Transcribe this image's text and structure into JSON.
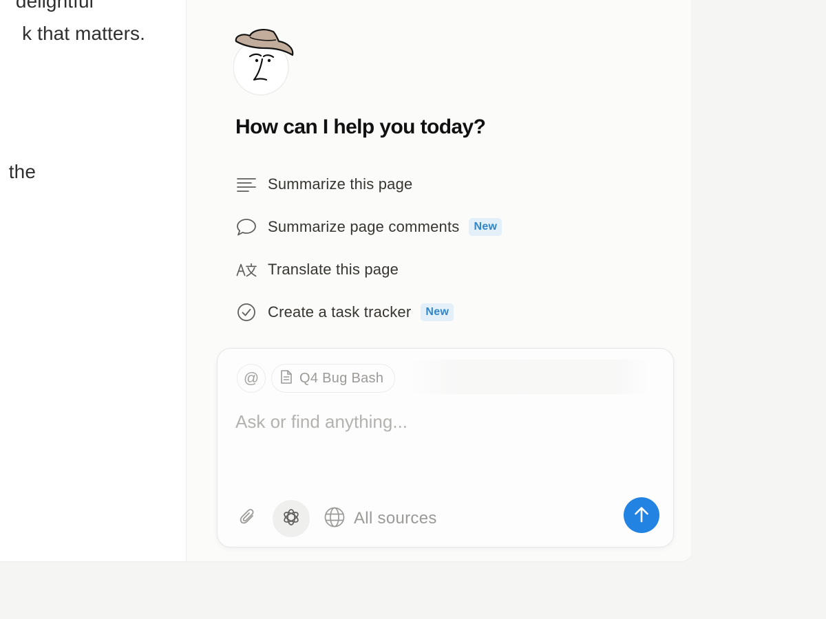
{
  "document": {
    "lines": [
      "delightful",
      "k that matters.",
      "the"
    ]
  },
  "assistant": {
    "greeting": "How can I help you today?",
    "suggestions": [
      {
        "label": "Summarize this page",
        "icon": "lines-icon",
        "badge": ""
      },
      {
        "label": "Summarize page comments",
        "icon": "speech-bubble-icon",
        "badge": "New"
      },
      {
        "label": "Translate this page",
        "icon": "translate-icon",
        "badge": ""
      },
      {
        "label": "Create a task tracker",
        "icon": "check-circle-icon",
        "badge": "New"
      }
    ]
  },
  "composer": {
    "mention_icon": "at-sign-icon",
    "context_page": "Q4 Bug Bash",
    "placeholder": "Ask or find anything...",
    "sources_label": "All sources"
  },
  "colors": {
    "accent": "#2383e2",
    "badge_text": "#2f86c9",
    "badge_bg": "#e3eff9"
  }
}
